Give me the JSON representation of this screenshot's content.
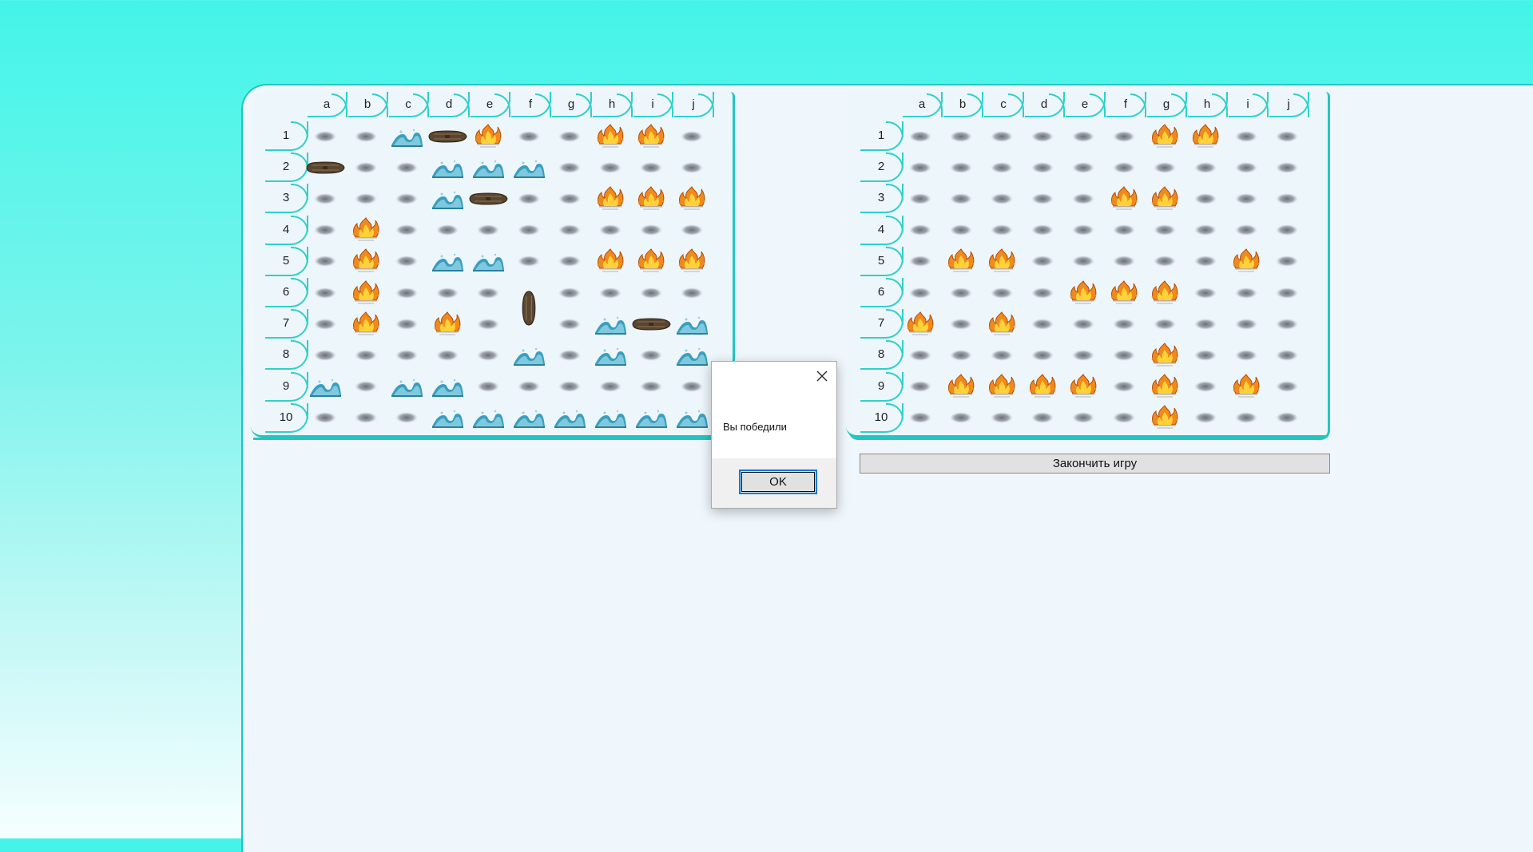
{
  "columns": [
    "a",
    "b",
    "c",
    "d",
    "e",
    "f",
    "g",
    "h",
    "i",
    "j"
  ],
  "rows": [
    "1",
    "2",
    "3",
    "4",
    "5",
    "6",
    "7",
    "8",
    "9",
    "10"
  ],
  "boards": [
    {
      "id": "player-board",
      "cells": [
        [
          "empty",
          "empty",
          "splash",
          "ship-h",
          "hit",
          "empty",
          "empty",
          "hit",
          "hit",
          "empty"
        ],
        [
          "ship-h",
          "empty",
          "empty",
          "splash",
          "splash",
          "splash",
          "empty",
          "empty",
          "empty",
          "empty"
        ],
        [
          "empty",
          "empty",
          "empty",
          "splash",
          "ship-h",
          "empty",
          "empty",
          "hit",
          "hit",
          "hit"
        ],
        [
          "empty",
          "hit",
          "empty",
          "empty",
          "empty",
          "empty",
          "empty",
          "empty",
          "empty",
          "empty"
        ],
        [
          "empty",
          "hit",
          "empty",
          "splash",
          "splash",
          "empty",
          "empty",
          "hit",
          "hit",
          "hit"
        ],
        [
          "empty",
          "hit",
          "empty",
          "empty",
          "empty",
          "ship-v",
          "empty",
          "empty",
          "empty",
          "empty"
        ],
        [
          "empty",
          "hit",
          "empty",
          "hit",
          "empty",
          "ship-v",
          "empty",
          "splash",
          "ship-h",
          "splash"
        ],
        [
          "empty",
          "empty",
          "empty",
          "empty",
          "empty",
          "splash",
          "empty",
          "splash",
          "empty",
          "splash"
        ],
        [
          "splash",
          "empty",
          "splash",
          "splash",
          "empty",
          "empty",
          "empty",
          "empty",
          "empty",
          "empty"
        ],
        [
          "empty",
          "empty",
          "empty",
          "splash",
          "splash",
          "splash",
          "splash",
          "splash",
          "splash",
          "splash"
        ]
      ]
    },
    {
      "id": "enemy-board",
      "cells": [
        [
          "empty",
          "empty",
          "empty",
          "empty",
          "empty",
          "empty",
          "hit",
          "hit",
          "empty",
          "empty"
        ],
        [
          "empty",
          "empty",
          "empty",
          "empty",
          "empty",
          "empty",
          "empty",
          "empty",
          "empty",
          "empty"
        ],
        [
          "empty",
          "empty",
          "empty",
          "empty",
          "empty",
          "hit",
          "hit",
          "empty",
          "empty",
          "empty"
        ],
        [
          "empty",
          "empty",
          "empty",
          "empty",
          "empty",
          "empty",
          "empty",
          "empty",
          "empty",
          "empty"
        ],
        [
          "empty",
          "hit",
          "hit",
          "empty",
          "empty",
          "empty",
          "empty",
          "empty",
          "hit",
          "empty"
        ],
        [
          "empty",
          "empty",
          "empty",
          "empty",
          "hit",
          "hit",
          "hit",
          "empty",
          "empty",
          "empty"
        ],
        [
          "hit",
          "empty",
          "hit",
          "empty",
          "empty",
          "empty",
          "empty",
          "empty",
          "empty",
          "empty"
        ],
        [
          "empty",
          "empty",
          "empty",
          "empty",
          "empty",
          "empty",
          "hit",
          "empty",
          "empty",
          "empty"
        ],
        [
          "empty",
          "hit",
          "hit",
          "hit",
          "hit",
          "empty",
          "hit",
          "empty",
          "hit",
          "empty"
        ],
        [
          "empty",
          "empty",
          "empty",
          "empty",
          "empty",
          "empty",
          "hit",
          "empty",
          "empty",
          "empty"
        ]
      ]
    }
  ],
  "end_game_label": "Закончить игру",
  "dialog": {
    "message": "Вы победили",
    "ok_label": "OK"
  },
  "colors": {
    "accent": "#22c6c1",
    "fire": "#f08a1c",
    "wave": "#3a9fbf",
    "ship": "#5a4630"
  }
}
